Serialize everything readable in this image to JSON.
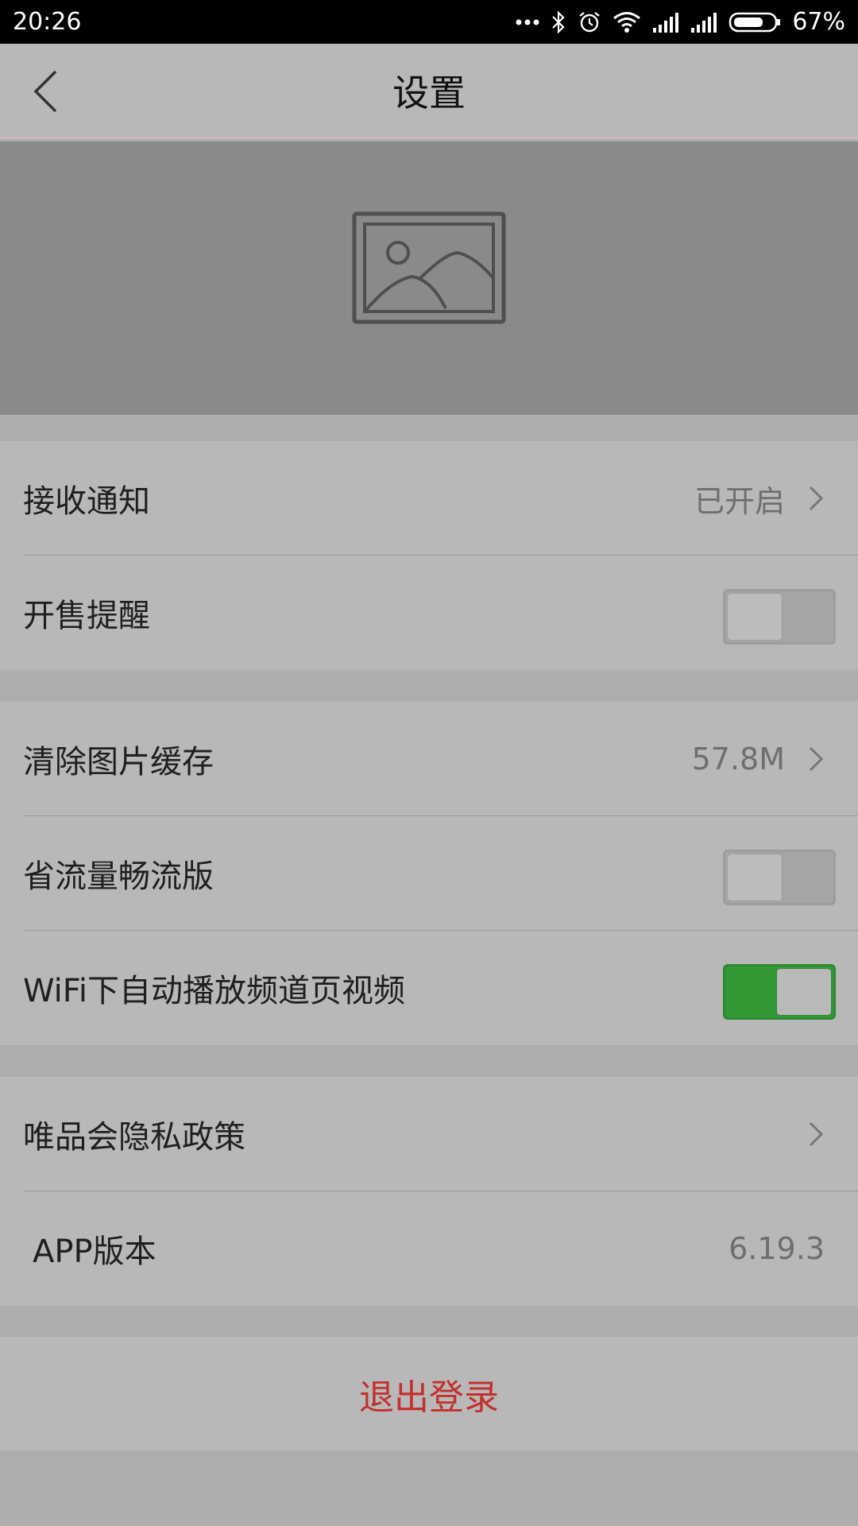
{
  "status_bar": {
    "time": "20:26",
    "battery": "67%",
    "icons": [
      "more-dots-icon",
      "bluetooth-icon",
      "alarm-icon",
      "wifi-icon",
      "signal-icon",
      "signal-icon",
      "battery-icon"
    ]
  },
  "header": {
    "title": "设置"
  },
  "banner": {
    "icon": "image-placeholder-icon"
  },
  "group1": {
    "notify": {
      "label": "接收通知",
      "value": "已开启"
    },
    "sale_reminder": {
      "label": "开售提醒",
      "toggle": "off"
    }
  },
  "group2": {
    "clear_cache": {
      "label": "清除图片缓存",
      "value": "57.8M"
    },
    "data_saver": {
      "label": "省流量畅流版",
      "toggle": "off"
    },
    "wifi_autoplay": {
      "label": "WiFi下自动播放频道页视频",
      "toggle": "on"
    }
  },
  "group3": {
    "privacy": {
      "label": "唯品会隐私政策"
    },
    "version": {
      "label": "APP版本",
      "value": "6.19.3"
    }
  },
  "logout": {
    "label": "退出登录"
  },
  "colors": {
    "toggle_on": "#339935",
    "logout_text": "#c3302d",
    "banner_bg": "#8a8a8a",
    "row_bg": "#b8b8b8"
  }
}
